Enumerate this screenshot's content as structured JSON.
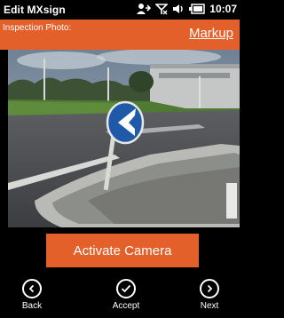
{
  "app": {
    "title": "Edit MXsign"
  },
  "status": {
    "time": "10:07"
  },
  "header": {
    "label": "Inspection Photo:",
    "markup_link": "Markup"
  },
  "camera": {
    "activate_label": "Activate Camera"
  },
  "nav": {
    "back_label": "Back",
    "accept_label": "Accept",
    "next_label": "Next"
  },
  "colors": {
    "accent": "#e4602a",
    "background": "#000000"
  },
  "icons": {
    "status": [
      "sync-person-icon",
      "no-signal-icon",
      "volume-icon",
      "battery-icon"
    ],
    "back": "chevron-left-circle-icon",
    "accept": "checkmark-circle-icon",
    "next": "chevron-right-circle-icon"
  }
}
